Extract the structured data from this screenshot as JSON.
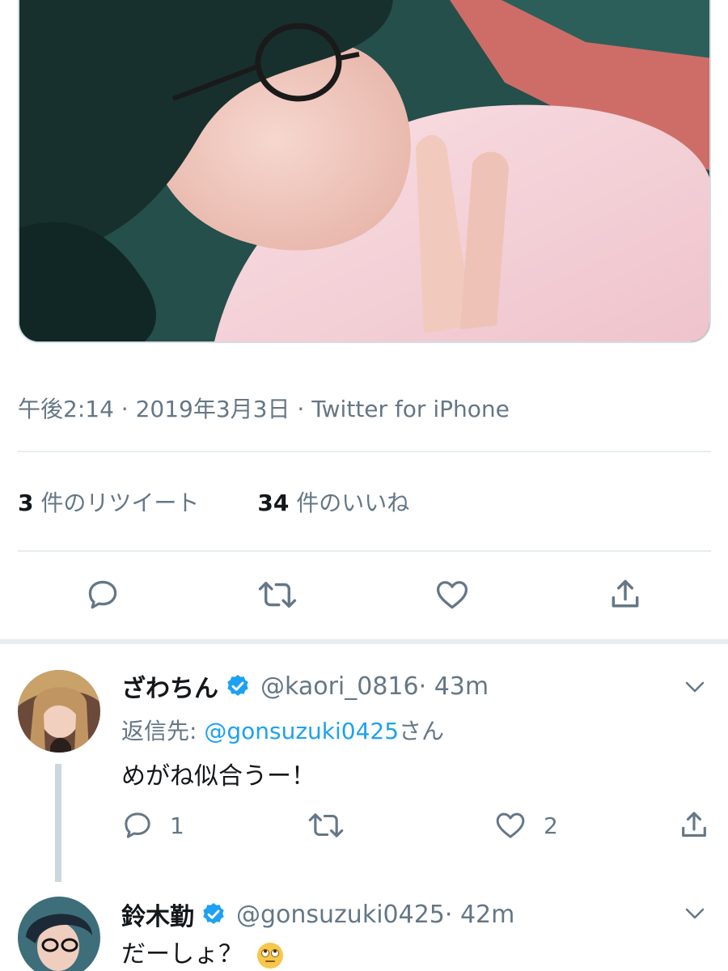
{
  "tweet": {
    "time": "午後2:14",
    "date": "2019年3月3日",
    "source": "Twitter for iPhone",
    "retweets_count": "3",
    "retweets_label": "件のリツイート",
    "likes_count": "34",
    "likes_label": "件のいいね"
  },
  "actions": {
    "icons": [
      "reply-icon",
      "retweet-icon",
      "like-icon",
      "share-icon"
    ]
  },
  "replies": [
    {
      "name": "ざわちん",
      "handle": "@kaori_0816",
      "time": "43m",
      "reply_to_prefix": "返信先: ",
      "reply_to_mention": "@gonsuzuki0425",
      "reply_to_suffix": "さん",
      "text": "めがね似合うー！",
      "reply_count": "1",
      "retweet_count": "",
      "like_count": "2"
    },
    {
      "name": "鈴木勤",
      "handle": "@gonsuzuki0425",
      "time": "42m",
      "text": "だーしょ？"
    }
  ],
  "colors": {
    "accent": "#1da1f2",
    "muted": "#657786",
    "divider": "#e6ecf0",
    "icon": "#657786"
  }
}
